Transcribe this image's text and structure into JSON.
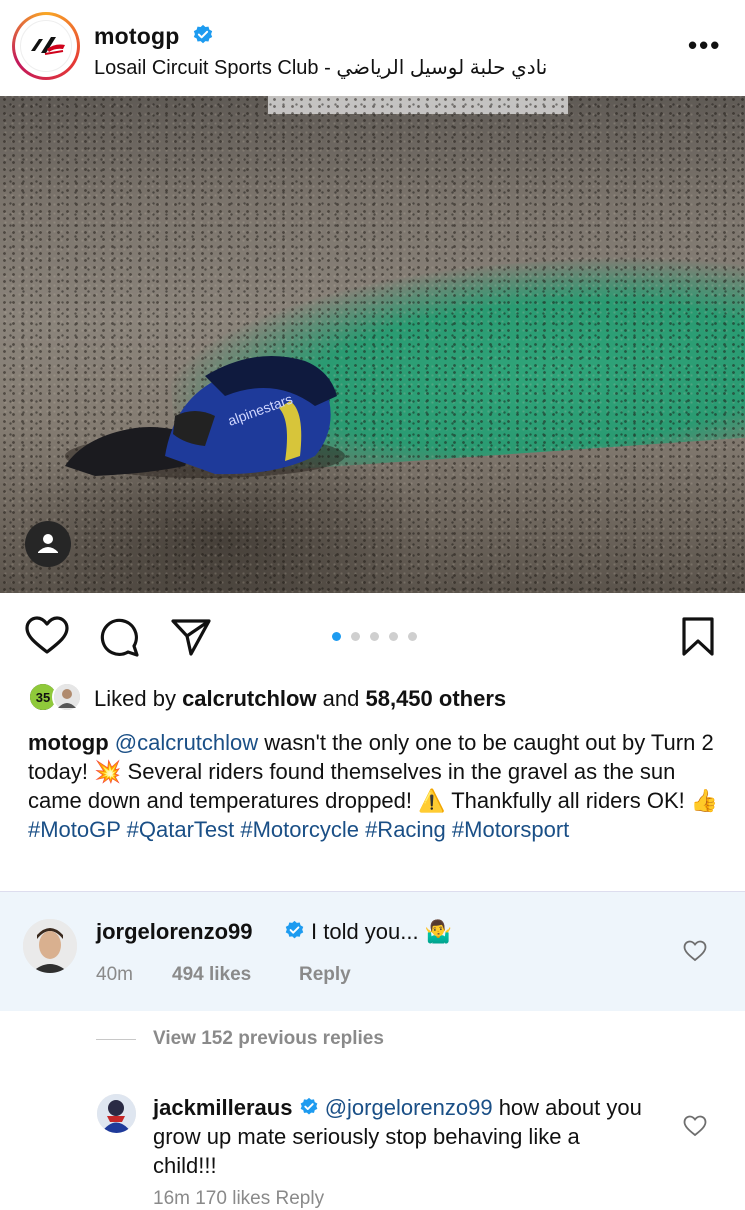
{
  "post": {
    "username": "motogp",
    "location": "Losail Circuit Sports Club - نادي حلبة لوسيل الرياضي",
    "more_label": "•••",
    "image_alt": "MotoGP rider crashed in gravel trap",
    "carousel": {
      "count": 5,
      "active": 0
    }
  },
  "likes": {
    "prefix": "Liked by ",
    "user": "calcrutchlow",
    "middle": " and ",
    "count": "58,450 others",
    "badge": "35"
  },
  "caption": {
    "username": "motogp",
    "mention": "@calcrutchlow",
    "text1": " wasn't the only one to be caught out by Turn 2 today! 💥 Several riders found themselves in the gravel as the sun came down and temperatures dropped! ⚠️ Thankfully all riders OK! 👍 ",
    "hashtags": "#MotoGP #QatarTest #Motorcycle #Racing #Motorsport"
  },
  "comments": [
    {
      "username": "jorgelorenzo99",
      "text": "I told you... 🤷‍♂️",
      "time": "40m",
      "likes": "494 likes",
      "reply": "Reply"
    }
  ],
  "view_replies": "View 152 previous replies",
  "reply": {
    "username": "jackmilleraus",
    "mention": "@jorgelorenzo99",
    "text": " how about you grow up mate seriously stop behaving like a child!!!",
    "meta_cut": "16m   170 likes   Reply"
  },
  "colors": {
    "verified": "#1d9bf0",
    "link": "#1a4f86",
    "active_dot": "#1d9bf0",
    "comment_bg": "#eef5fb"
  },
  "icons": [
    "heart-icon",
    "comment-icon",
    "share-icon",
    "bookmark-icon",
    "tag-user-icon",
    "more-icon",
    "verified-icon"
  ]
}
